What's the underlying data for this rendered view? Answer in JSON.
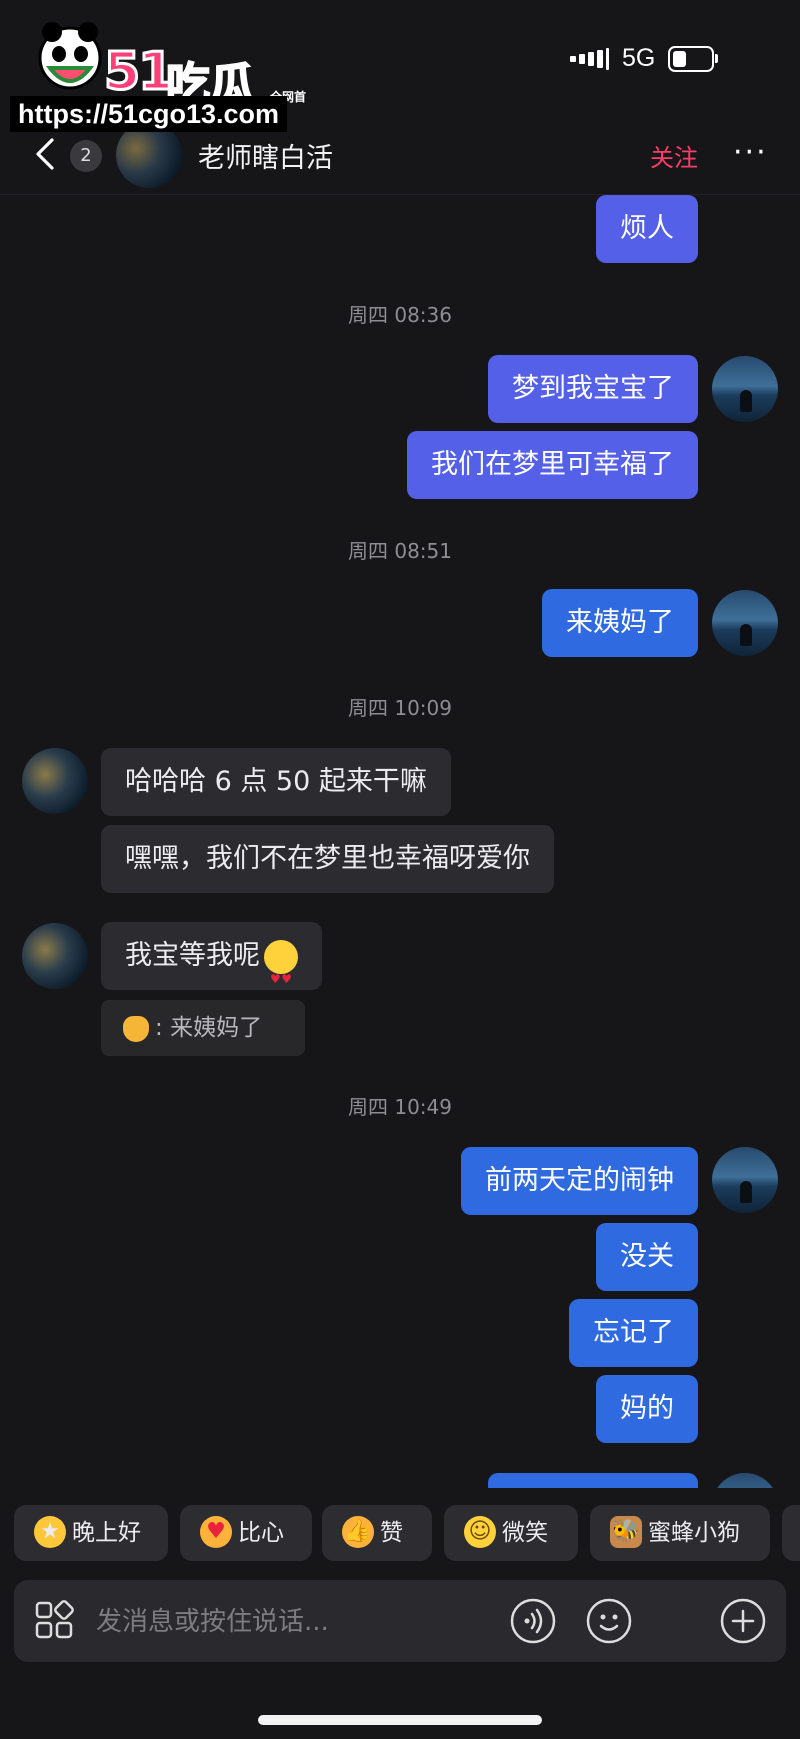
{
  "watermark": {
    "brand": "51",
    "brand_cn": "吃瓜",
    "tag": "全网首发",
    "url": "https://51cgo13.com"
  },
  "status_bar": {
    "network": "5G",
    "battery_level": 0.35
  },
  "header": {
    "unread_count": "2",
    "contact_name": "老师瞎白活",
    "follow_label": "关注",
    "more_label": "···"
  },
  "messages": {
    "m1": "烦人",
    "t1": "周四 08:36",
    "m2": "梦到我宝宝了",
    "m3": "我们在梦里可幸福了",
    "t2": "周四 08:51",
    "m4": "来姨妈了",
    "t3": "周四 10:09",
    "m5": "哈哈哈 6 点 50 起来干嘛",
    "m6": "嘿嘿，我们不在梦里也幸福呀爱你",
    "m7": "我宝等我呢",
    "m7_reply_quote": "来姨妈了",
    "m7_reply_sep": ":",
    "t4": "周四 10:49",
    "m8": "前两天定的闹钟",
    "m9": "没关",
    "m10": "忘记了",
    "m11": "妈的"
  },
  "quick_replies": [
    {
      "label": "晚上好",
      "icon": "star-face-icon"
    },
    {
      "label": "比心",
      "icon": "heart-hand-icon"
    },
    {
      "label": "赞",
      "icon": "thumbs-up-icon"
    },
    {
      "label": "微笑",
      "icon": "smile-icon"
    },
    {
      "label": "蜜蜂小狗",
      "icon": "bee-dog-icon"
    }
  ],
  "input": {
    "placeholder": "发消息或按住说话..."
  },
  "colors": {
    "outgoing": "#5560e8",
    "outgoing_alt": "#2f6ae0",
    "incoming": "#2c2c30",
    "follow": "#ff3d6a",
    "background": "#161619"
  }
}
